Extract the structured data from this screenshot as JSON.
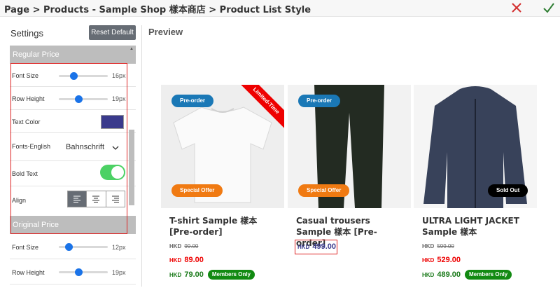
{
  "header": {
    "breadcrumb": "Page > Products - Sample Shop 樣本商店 > Product List Style"
  },
  "settings": {
    "title": "Settings",
    "reset_label": "Reset Default",
    "regular_price": {
      "heading": "Regular Price",
      "font_size_label": "Font Size",
      "font_size_value": "16px",
      "font_size_level": 0.3,
      "row_height_label": "Row Height",
      "row_height_value": "19px",
      "row_height_level": 0.4,
      "text_color_label": "Text Color",
      "text_color": "#3a3a8c",
      "fonts_english_label": "Fonts-English",
      "fonts_english_value": "Bahnschrift",
      "bold_text_label": "Bold Text",
      "bold_text_on": true,
      "align_label": "Align",
      "align_value": "left"
    },
    "original_price": {
      "heading": "Original Price",
      "font_size_label": "Font Size",
      "font_size_value": "12px",
      "font_size_level": 0.2,
      "row_height_label": "Row Height",
      "row_height_value": "19px",
      "row_height_level": 0.4
    }
  },
  "preview": {
    "title": "Preview",
    "products": [
      {
        "name": "T-shirt Sample 樣本 [Pre-order]",
        "badge_top": "Pre-order",
        "badge_bottom": "Special Offer",
        "ribbon": "Limited-Time",
        "orig_cur": "HKD",
        "orig_amt": "99.00",
        "sale_cur": "HKD",
        "sale_amt": "89.00",
        "mem_cur": "HKD",
        "mem_amt": "79.00",
        "members": "Members Only"
      },
      {
        "name": "Casual trousers Sample 樣本 [Pre-order]",
        "badge_top": "Pre-order",
        "badge_bottom": "Special Offer",
        "reg_cur": "HKD",
        "reg_amt": "499.00"
      },
      {
        "name": "ULTRA LIGHT JACKET Sample 樣本",
        "badge_bottom": "Sold Out",
        "orig_cur": "HKD",
        "orig_amt": "599.00",
        "sale_cur": "HKD",
        "sale_amt": "529.00",
        "mem_cur": "HKD",
        "mem_amt": "489.00",
        "members": "Members Only"
      }
    ]
  },
  "colors": {
    "accent": "#1a73e8",
    "sale": "#e00000",
    "member": "#1a7a1a",
    "regular": "#3a3a8c"
  },
  "icons": {
    "close": "close-icon",
    "confirm": "check-icon"
  }
}
